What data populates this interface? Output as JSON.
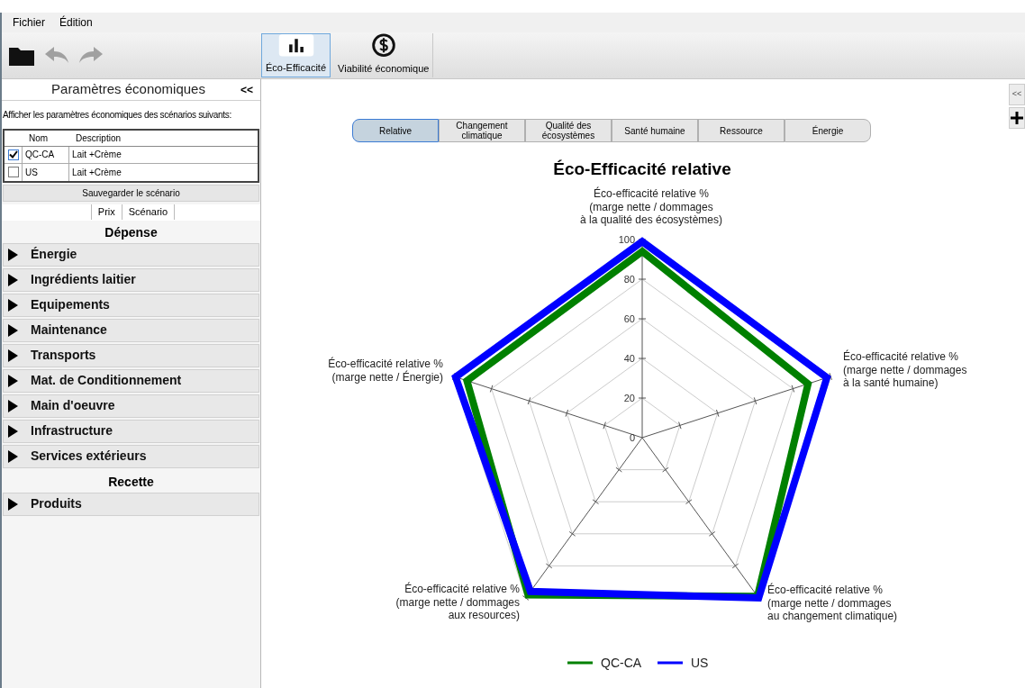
{
  "menu": [
    "Fichier",
    "Édition"
  ],
  "toolbar_tabs": [
    {
      "label": "Éco-Efficacité",
      "kind": "chart",
      "selected": true
    },
    {
      "label": "Viabilité économique",
      "kind": "money",
      "selected": false
    }
  ],
  "sidebar": {
    "title": "Paramètres économiques",
    "collapse": "<<",
    "hint": "Afficher les paramètres économiques des scénarios suivants:",
    "table": {
      "columns": [
        "Nom",
        "Description"
      ],
      "rows": [
        {
          "checked": true,
          "name": "QC-CA",
          "description": "Lait +Crème"
        },
        {
          "checked": false,
          "name": "US",
          "description": "Lait +Crème"
        }
      ]
    },
    "save_button": "Sauvegarder le scénario",
    "tabs": [
      "Prix",
      "Scénario"
    ],
    "sections": [
      {
        "title": "Dépense",
        "items": [
          "Énergie",
          "Ingrédients laitier",
          "Equipements",
          "Maintenance",
          "Transports",
          "Mat. de Conditionnement",
          "Main d'oeuvre",
          "Infrastructure",
          "Services extérieurs"
        ]
      },
      {
        "title": "Recette",
        "items": [
          "Produits"
        ]
      }
    ]
  },
  "side_buttons": {
    "collapse": "<<"
  },
  "view_tabs": [
    {
      "label": "Relative",
      "selected": true
    },
    {
      "label": "Changement\nclimatique",
      "selected": false
    },
    {
      "label": "Qualité des\nécosystèmes",
      "selected": false
    },
    {
      "label": "Santé humaine",
      "selected": false
    },
    {
      "label": "Ressource",
      "selected": false
    },
    {
      "label": "Énergie",
      "selected": false
    }
  ],
  "chart_data": {
    "type": "radar",
    "title": "Éco-Efficacité relative",
    "categories": [
      "Éco-efficacité relative %\n(marge nette / dommages\nà la qualité des écosystèmes)",
      "Éco-efficacité relative %\n(marge nette / dommages\nà la santé humaine)",
      "Éco-efficacité relative %\n(marge nette / dommages\nau changement climatique)",
      "Éco-efficacité relative %\n(marge nette / dommages\naux resources)",
      "Éco-efficacité relative %\n(marge nette / Énergie)"
    ],
    "legend": "bottom",
    "ylim": [
      0,
      100
    ],
    "yticks": [
      0,
      20,
      40,
      60,
      80,
      100
    ],
    "series": [
      {
        "name": "QC-CA",
        "color": "#008000",
        "values": [
          94,
          88,
          99,
          98,
          93
        ]
      },
      {
        "name": "US",
        "color": "#0000ff",
        "values": [
          99,
          98,
          100,
          96,
          99
        ]
      }
    ]
  }
}
